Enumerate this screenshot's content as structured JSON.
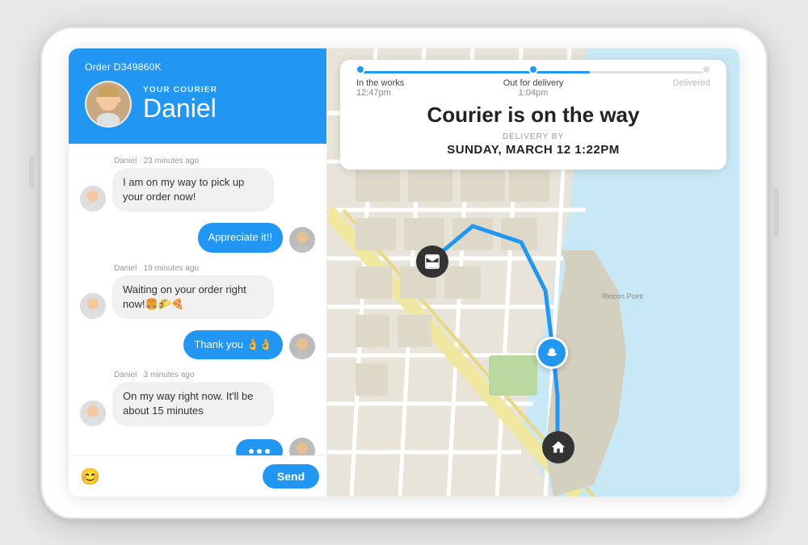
{
  "device": {
    "background": "#e8e8e8"
  },
  "header": {
    "order_id": "Order D349860K",
    "courier_label": "YOUR COURIER",
    "courier_name": "Daniel"
  },
  "status_card": {
    "progress_steps": [
      {
        "label": "In the works",
        "time": "12:47pm",
        "active": true
      },
      {
        "label": "Out for delivery",
        "time": "1:04pm",
        "active": true
      },
      {
        "label": "Delivered",
        "time": "",
        "active": false
      }
    ],
    "main_status": "Courier is on the way",
    "delivery_by_label": "DELIVERY BY",
    "delivery_time": "SUNDAY, MARCH 12 1:22PM"
  },
  "messages": [
    {
      "sender": "Daniel",
      "time": "23 minutes ago",
      "text": "I am on my way to pick up your order now!",
      "outgoing": false
    },
    {
      "sender": "me",
      "time": "",
      "text": "Appreciate it!!",
      "outgoing": true
    },
    {
      "sender": "Daniel",
      "time": "19 minutes ago",
      "text": "Waiting on your order right now!🍔🌮🍕",
      "outgoing": false
    },
    {
      "sender": "me",
      "time": "",
      "text": "Thank you 👌👌",
      "outgoing": true
    },
    {
      "sender": "Daniel",
      "time": "3 minutes ago",
      "text": "On my way right now. It'll be about 15 minutes",
      "outgoing": false
    },
    {
      "sender": "me",
      "time": "",
      "text": "typing",
      "outgoing": true,
      "is_typing": true
    }
  ],
  "chat_input": {
    "send_label": "Send",
    "emoji_icon": "😊",
    "placeholder": ""
  }
}
